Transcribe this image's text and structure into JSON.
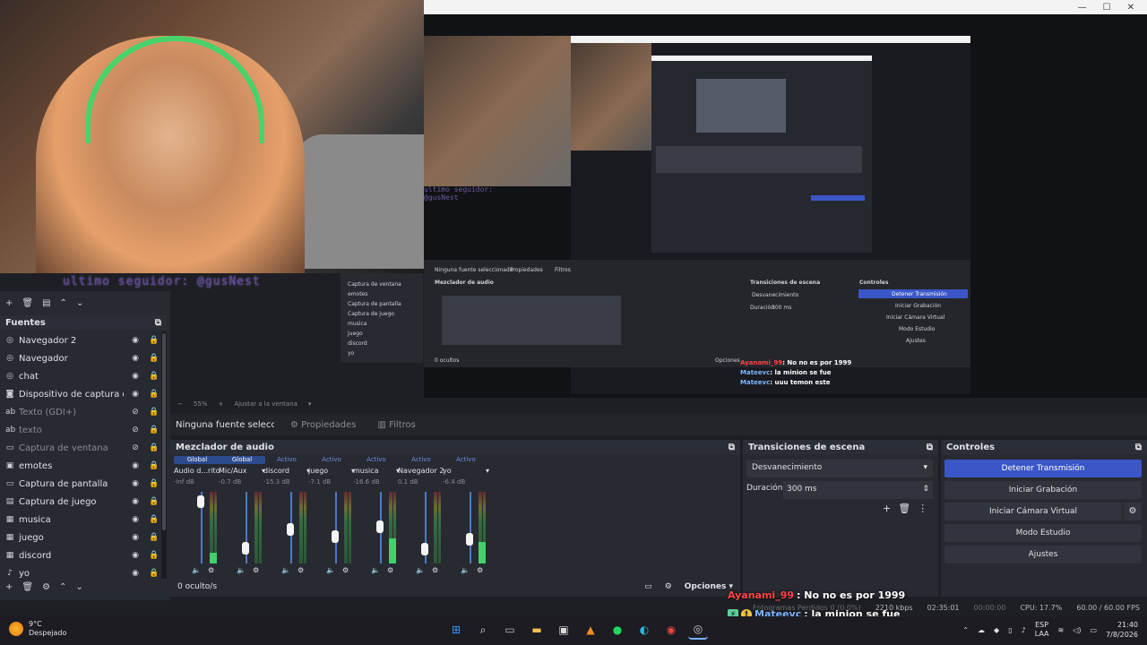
{
  "overlay_text": "ultimo seguidor: @gusNest",
  "preview": {
    "window_controls": [
      "—",
      "☐",
      "✕"
    ],
    "zoom_label": "55%",
    "fit_label": "Ajustar a la ventana"
  },
  "nested": {
    "sources": [
      "Captura de ventana",
      "emotes",
      "Captura de pantalla",
      "Captura de juego",
      "musica",
      "juego",
      "discord",
      "yo"
    ],
    "no_source": "Ninguna fuente seleccionada",
    "properties": "Propiedades",
    "filters": "Filtros",
    "mixer_title": "Mezclador de audio",
    "transitions_title": "Transiciones de escena",
    "controls_title": "Controles",
    "transition": "Desvanecimiento",
    "duration_label": "Duración",
    "duration": "300 ms",
    "buttons": [
      "Detener Transmisión",
      "Iniciar Grabación",
      "Iniciar Cámara Virtual",
      "Modo Estudio",
      "Ajustes"
    ],
    "hidden": "0 ocultos",
    "options": "Opciones",
    "chat": [
      {
        "user": "Ayanami_99",
        "msg": ": No no es por 1999"
      },
      {
        "user": "Mateevc",
        "msg": ": la minion se fue"
      },
      {
        "user": "Mateevc",
        "msg": ": uuu temon este"
      }
    ]
  },
  "sources_header": "Fuentes",
  "sources": [
    {
      "icon": "globe-icon",
      "glyph": "◎",
      "name": "Navegador 2",
      "dim": false,
      "hidden": false
    },
    {
      "icon": "globe-icon",
      "glyph": "◎",
      "name": "Navegador",
      "dim": false,
      "hidden": false
    },
    {
      "icon": "globe-icon",
      "glyph": "◎",
      "name": "chat",
      "dim": false,
      "hidden": false
    },
    {
      "icon": "camera-icon",
      "glyph": "◙",
      "name": "Dispositivo de captura de video",
      "dim": false,
      "hidden": false
    },
    {
      "icon": "text-icon",
      "glyph": "ab",
      "name": "Texto (GDI+)",
      "dim": true,
      "hidden": true
    },
    {
      "icon": "text-icon",
      "glyph": "ab",
      "name": "texto",
      "dim": true,
      "hidden": true
    },
    {
      "icon": "window-icon",
      "glyph": "▭",
      "name": "Captura de ventana",
      "dim": true,
      "hidden": true
    },
    {
      "icon": "image-icon",
      "glyph": "▣",
      "name": "emotes",
      "dim": false,
      "hidden": false
    },
    {
      "icon": "monitor-icon",
      "glyph": "▭",
      "name": "Captura de pantalla",
      "dim": false,
      "hidden": false
    },
    {
      "icon": "gamepad-icon",
      "glyph": "▤",
      "name": "Captura de juego",
      "dim": false,
      "hidden": false
    },
    {
      "icon": "audio-icon",
      "glyph": "▦",
      "name": "musica",
      "dim": false,
      "hidden": false
    },
    {
      "icon": "audio-icon",
      "glyph": "▦",
      "name": "juego",
      "dim": false,
      "hidden": false
    },
    {
      "icon": "audio-icon",
      "glyph": "▦",
      "name": "discord",
      "dim": false,
      "hidden": false
    },
    {
      "icon": "mic-icon",
      "glyph": "♪",
      "name": "yo",
      "dim": false,
      "hidden": false
    }
  ],
  "source_bar": {
    "no_source": "Ninguna fuente seleccionada",
    "properties": "Propiedades",
    "filters": "Filtros"
  },
  "mixer": {
    "title": "Mezclador de audio",
    "channels": [
      {
        "badge": "Global",
        "badge_active": false,
        "name": "Audio d...ritorio",
        "db": "-inf dB",
        "level": 0.15,
        "fader": 0.95
      },
      {
        "badge": "Global",
        "badge_active": false,
        "name": "Mic/Aux",
        "db": "-0.7 dB",
        "level": 0.0,
        "fader": 0.2
      },
      {
        "badge": "Activo",
        "badge_active": true,
        "name": "discord",
        "db": "-15.3 dB",
        "level": 0.0,
        "fader": 0.5
      },
      {
        "badge": "Activo",
        "badge_active": true,
        "name": "juego",
        "db": "-7.1 dB",
        "level": 0.0,
        "fader": 0.38
      },
      {
        "badge": "Activo",
        "badge_active": true,
        "name": "musica",
        "db": "-16.6 dB",
        "level": 0.35,
        "fader": 0.55
      },
      {
        "badge": "Activo",
        "badge_active": true,
        "name": "Navegador 2",
        "db": "0.1 dB",
        "level": 0.0,
        "fader": 0.18
      },
      {
        "badge": "Activo",
        "badge_active": true,
        "name": "yo",
        "db": "-6.4 dB",
        "level": 0.3,
        "fader": 0.35
      }
    ],
    "hidden_label": "0 oculto/s",
    "options_label": "Opciones"
  },
  "transitions": {
    "title": "Transiciones de escena",
    "selected": "Desvanecimiento",
    "duration_label": "Duración",
    "duration": "300 ms"
  },
  "controls": {
    "title": "Controles",
    "stop_stream": "Detener Transmisión",
    "start_record": "Iniciar Grabación",
    "virtual_cam": "Iniciar Cámara Virtual",
    "studio_mode": "Modo Estudio",
    "settings": "Ajustes"
  },
  "status": {
    "dropped": "Fotogramas Perdidos 0 (0.0%)",
    "bitrate": "2210 kbps",
    "live_time": "02:35:01",
    "rec_time": "00:00:00",
    "cpu": "CPU: 17.7%",
    "fps": "60.00 / 60.00 FPS"
  },
  "chat": [
    {
      "user": "Ayanami_99",
      "msg": ": No no es por 1999",
      "style": "user1",
      "badges": 0
    },
    {
      "user": "Mateevc",
      "msg": ": la minion se fue",
      "style": "user2",
      "badges": 2
    },
    {
      "user": "Mateevc",
      "msg": ": uuu temon este",
      "style": "user2",
      "badges": 2
    }
  ],
  "taskbar": {
    "temp": "9°C",
    "weather": "Despejado",
    "lang1": "ESP",
    "lang2": "LAA",
    "time": "21:40",
    "date": "7/8/2026"
  }
}
